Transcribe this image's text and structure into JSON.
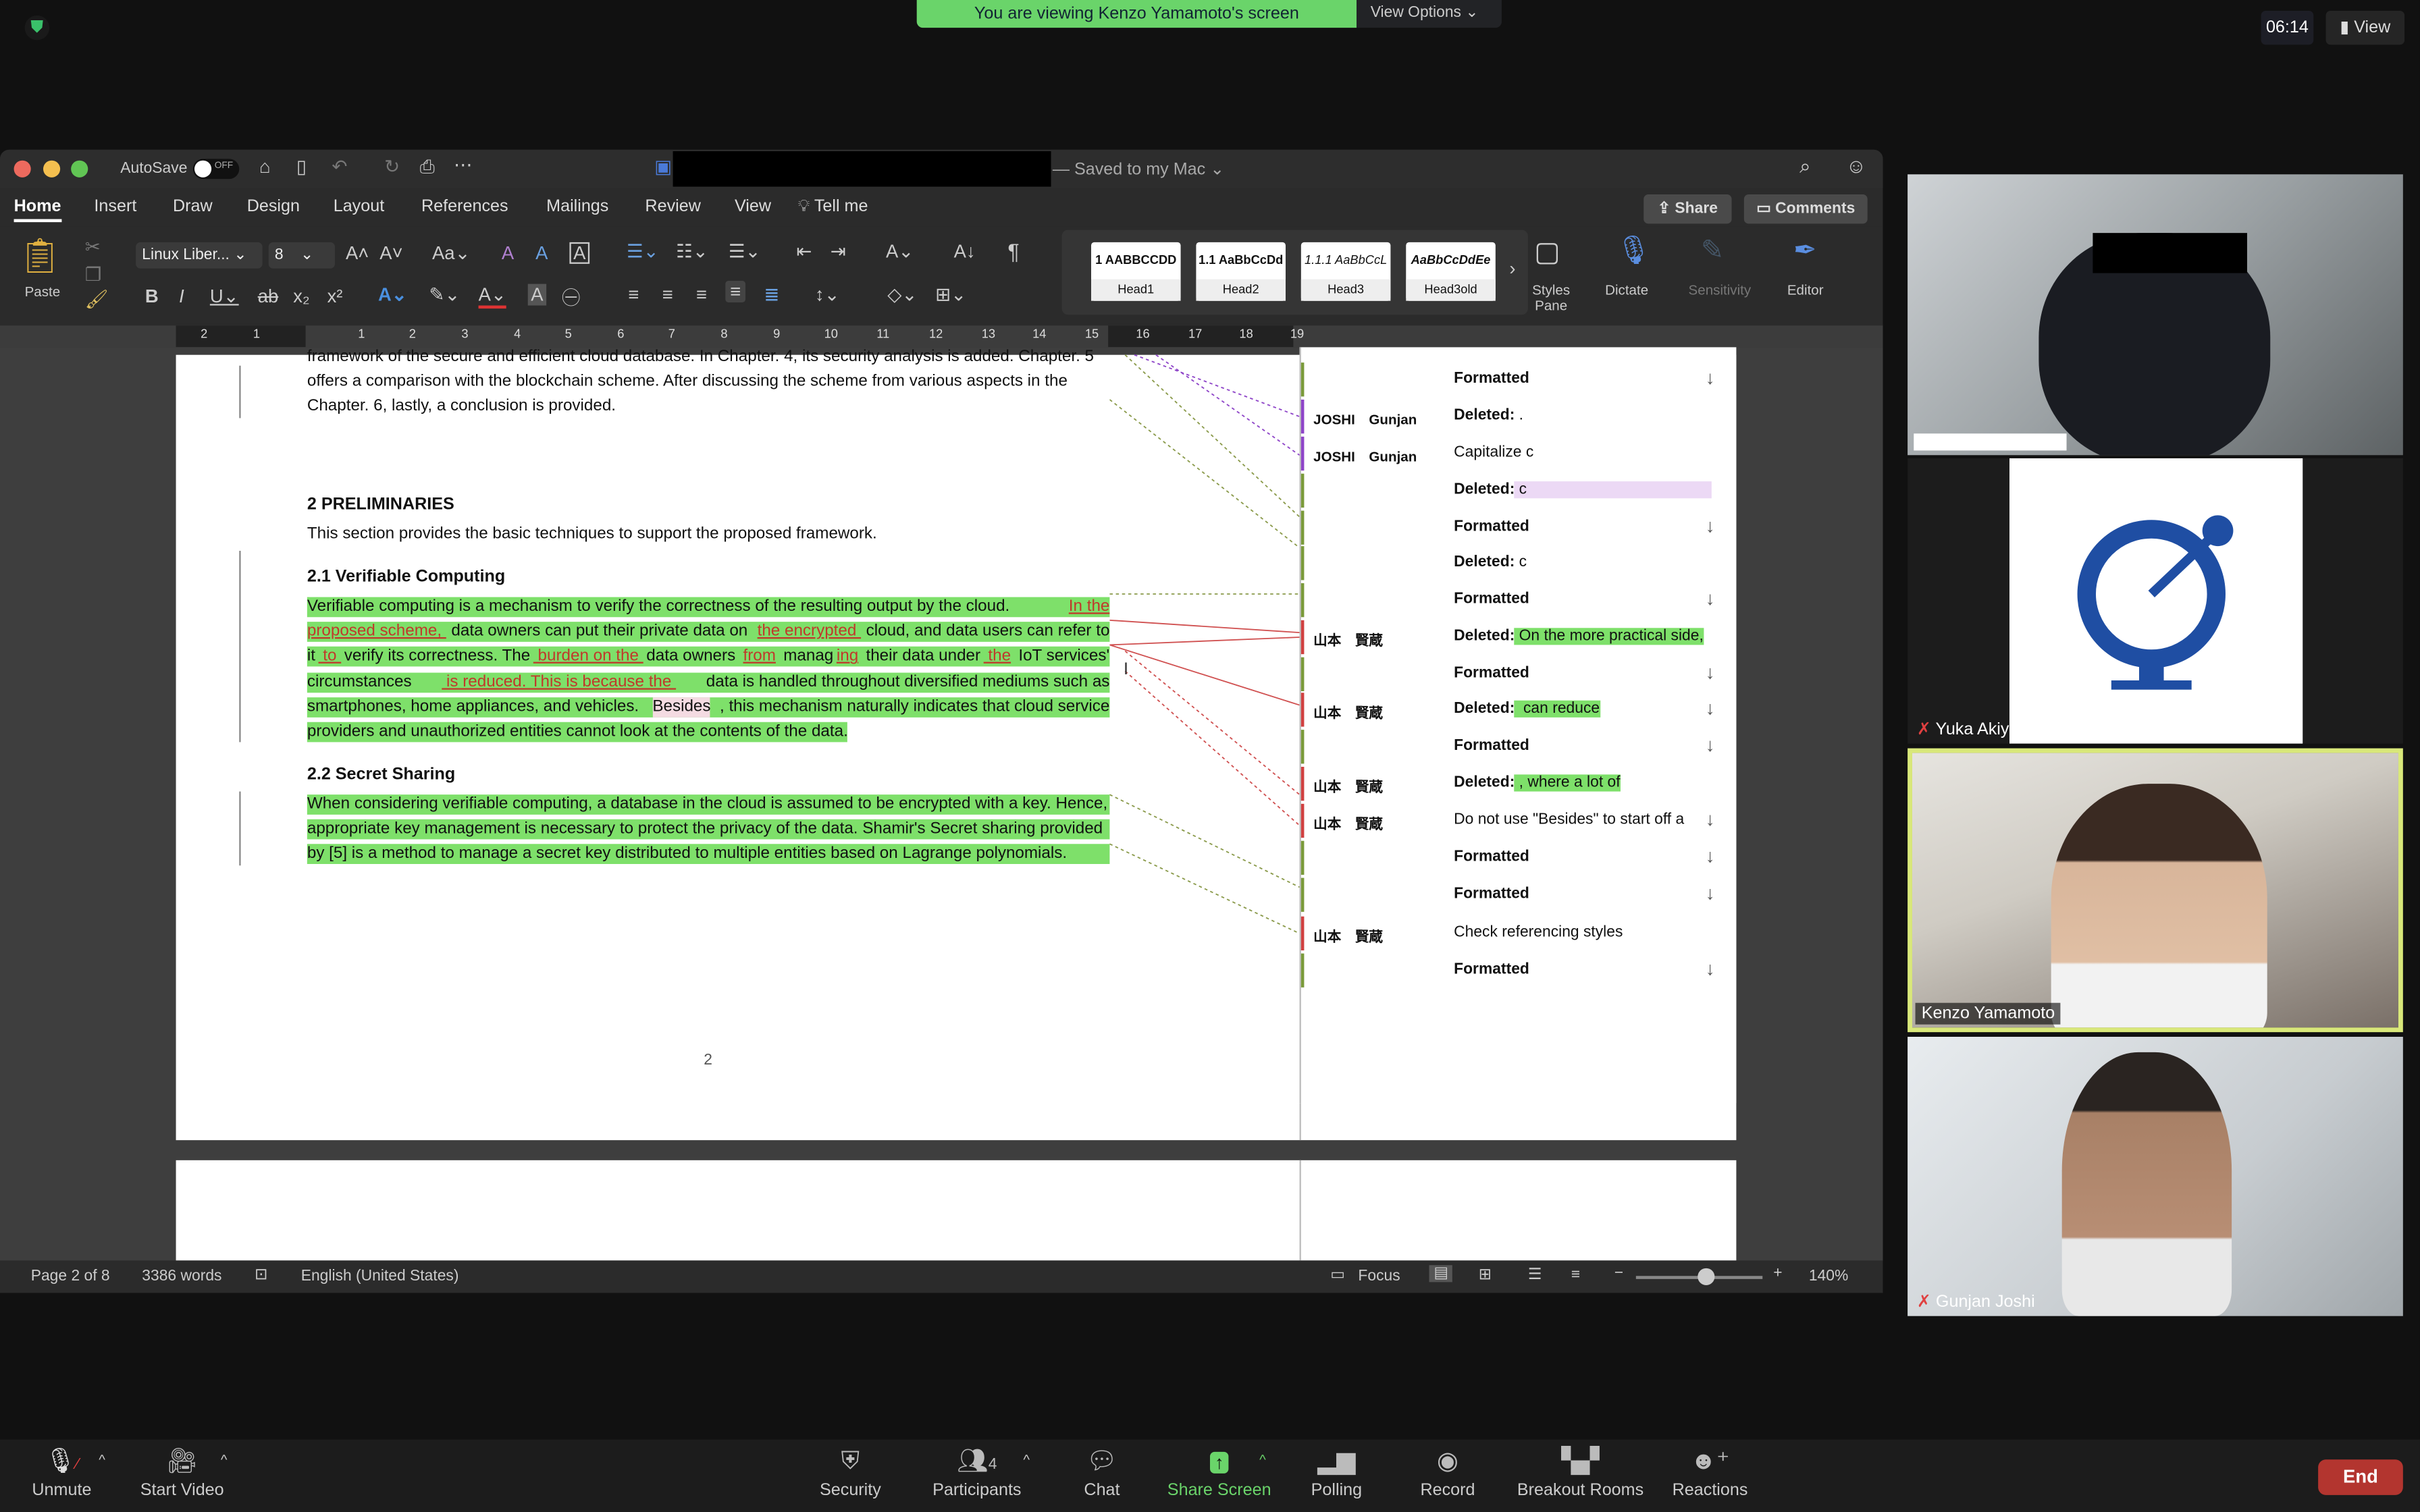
{
  "zoom_meeting": {
    "banner": "You are viewing Kenzo Yamamoto's screen",
    "view_options": "View Options ⌄",
    "time": "06:14",
    "view_label": "View",
    "participants": [
      {
        "name": ""
      },
      {
        "name": "Yuka Akiy"
      },
      {
        "name": "Kenzo Yamamoto",
        "active_speaker": true
      },
      {
        "name": "Gunjan Joshi"
      }
    ],
    "toolbar": {
      "unmute": "Unmute",
      "start_video": "Start Video",
      "security": "Security",
      "participants": "Participants",
      "participant_count": "4",
      "chat": "Chat",
      "share_screen": "Share Screen",
      "polling": "Polling",
      "record": "Record",
      "breakout_rooms": "Breakout Rooms",
      "reactions": "Reactions",
      "end": "End"
    },
    "colors": {
      "share_green": "#6ad46a",
      "end_red": "#b3352f",
      "speaker_border": "#d9e87a"
    }
  },
  "word": {
    "autosave": "AutoSave",
    "autosave_state": "OFF",
    "saved_status": "— Saved to my Mac ⌄",
    "tabs": [
      "Home",
      "Insert",
      "Draw",
      "Design",
      "Layout",
      "References",
      "Mailings",
      "Review",
      "View",
      "Tell me"
    ],
    "share": "Share",
    "comments": "Comments",
    "paste": "Paste",
    "font_name": "Linux Liber...",
    "font_size": "8",
    "styles": [
      {
        "preview": "1 AABBCCDD",
        "name": "Head1"
      },
      {
        "preview": "1.1 AaBbCcDd",
        "name": "Head2"
      },
      {
        "preview": "1.1.1 AaBbCcL",
        "name": "Head3"
      },
      {
        "preview": "AaBbCcDdEe",
        "name": "Head3old"
      }
    ],
    "styles_pane": "Styles Pane",
    "dictate": "Dictate",
    "sensitivity": "Sensitivity",
    "editor": "Editor",
    "ruler": [
      "2",
      "1",
      "",
      "1",
      "2",
      "3",
      "4",
      "5",
      "6",
      "7",
      "8",
      "9",
      "10",
      "11",
      "12",
      "13",
      "14",
      "15",
      "16",
      "17",
      "18",
      "19"
    ],
    "document": {
      "intro_lines": [
        "framework of the secure and efficient cloud database. In Chapter. 4, its security analysis is added. Chapter. 5",
        "offers a comparison with the blockchain scheme. After discussing the scheme from various aspects in the",
        "Chapter. 6, lastly, a conclusion is provided."
      ],
      "heading2": "2  PRELIMINARIES",
      "heading2_text": "This section provides the basic techniques to support the proposed framework.",
      "heading21": "2.1  Verifiable Computing",
      "para21": [
        [
          [
            "Verifiable computing is a mechanism to verify the correctness of the resulting output by the cloud. ",
            "n"
          ],
          [
            "In the",
            "i"
          ]
        ],
        [
          [
            "proposed scheme, ",
            "i"
          ],
          [
            "data owners can put their private data on ",
            "n"
          ],
          [
            "the encrypted ",
            "i"
          ],
          [
            "cloud, and data users can refer to",
            "n"
          ]
        ],
        [
          [
            "it",
            "n"
          ],
          [
            " to ",
            "i"
          ],
          [
            "verify its correctness. The",
            "n"
          ],
          [
            " burden on the ",
            "i"
          ],
          [
            "data owners ",
            "n"
          ],
          [
            "from",
            "i"
          ],
          [
            " manag",
            "n"
          ],
          [
            "ing",
            "i"
          ],
          [
            " their data under",
            "n"
          ],
          [
            " the",
            "i"
          ],
          [
            " IoT services'",
            "n"
          ]
        ],
        [
          [
            "circumstances",
            "n"
          ],
          [
            " is reduced. This is because the ",
            "i"
          ],
          [
            "data is handled throughout diversified mediums such as",
            "n"
          ]
        ],
        [
          [
            "smartphones, home appliances, and vehicles. ",
            "n"
          ],
          [
            "Besides",
            "c"
          ],
          [
            ", this mechanism naturally indicates that cloud service",
            "n"
          ]
        ],
        [
          [
            "providers and unauthorized entities cannot look at the contents of the data.",
            "n"
          ]
        ]
      ],
      "heading22": "2.2  Secret Sharing",
      "para22": [
        "When considering verifiable computing, a database in the cloud is assumed to be encrypted with a key. Hence,",
        "appropriate key management is necessary to protect the privacy of the data. Shamir's Secret sharing provided",
        "by [5] is a method to manage a secret key distributed to multiple entities based on Lagrange polynomials."
      ],
      "page_number": "2"
    },
    "markup": [
      {
        "author": "",
        "label": "Formatted",
        "text": "",
        "arrow": true,
        "color": "#7a9a3a"
      },
      {
        "author": "JOSHI　Gunjan",
        "label": "Deleted:",
        "text": " .",
        "arrow": false,
        "color": "#8e44c8"
      },
      {
        "author": "JOSHI　Gunjan",
        "label": "",
        "text": "Capitalize c",
        "arrow": false,
        "color": "#8e44c8"
      },
      {
        "author": "",
        "label": "Deleted:",
        "text": " c",
        "arrow": false,
        "color": "#7a9a3a",
        "hl": "#ecd9f5"
      },
      {
        "author": "",
        "label": "Formatted",
        "text": "",
        "arrow": true,
        "color": "#7a9a3a"
      },
      {
        "author": "",
        "label": "Deleted:",
        "text": " c",
        "arrow": false,
        "color": "#7a9a3a"
      },
      {
        "author": "",
        "label": "Formatted",
        "text": "",
        "arrow": true,
        "color": "#7a9a3a"
      },
      {
        "author": "山本　賢蔵",
        "label": "Deleted:",
        "text": " On the more practical side,",
        "arrow": false,
        "color": "#d04040",
        "hl": "#7ee06a"
      },
      {
        "author": "",
        "label": "Formatted",
        "text": "",
        "arrow": true,
        "color": "#7a9a3a"
      },
      {
        "author": "山本　賢蔵",
        "label": "Deleted:",
        "text": "  can reduce",
        "arrow": true,
        "color": "#d04040",
        "hl": "#7ee06a"
      },
      {
        "author": "",
        "label": "Formatted",
        "text": "",
        "arrow": true,
        "color": "#7a9a3a"
      },
      {
        "author": "山本　賢蔵",
        "label": "Deleted:",
        "text": " , where a lot of",
        "arrow": false,
        "color": "#d04040",
        "hl": "#7ee06a"
      },
      {
        "author": "山本　賢蔵",
        "label": "",
        "text": "Do not use \"Besides\" to start off a",
        "arrow": true,
        "color": "#d04040"
      },
      {
        "author": "",
        "label": "Formatted",
        "text": "",
        "arrow": true,
        "color": "#7a9a3a"
      },
      {
        "author": "",
        "label": "Formatted",
        "text": "",
        "arrow": true,
        "color": "#7a9a3a"
      },
      {
        "author": "山本　賢蔵",
        "label": "",
        "text": "Check referencing styles",
        "arrow": false,
        "color": "#d04040"
      },
      {
        "author": "",
        "label": "Formatted",
        "text": "",
        "arrow": true,
        "color": "#7a9a3a"
      }
    ],
    "status": {
      "page": "Page 2 of 8",
      "words": "3386 words",
      "language": "English (United States)",
      "focus": "Focus",
      "zoom": "140%",
      "zoom_level_percent": 140
    }
  }
}
